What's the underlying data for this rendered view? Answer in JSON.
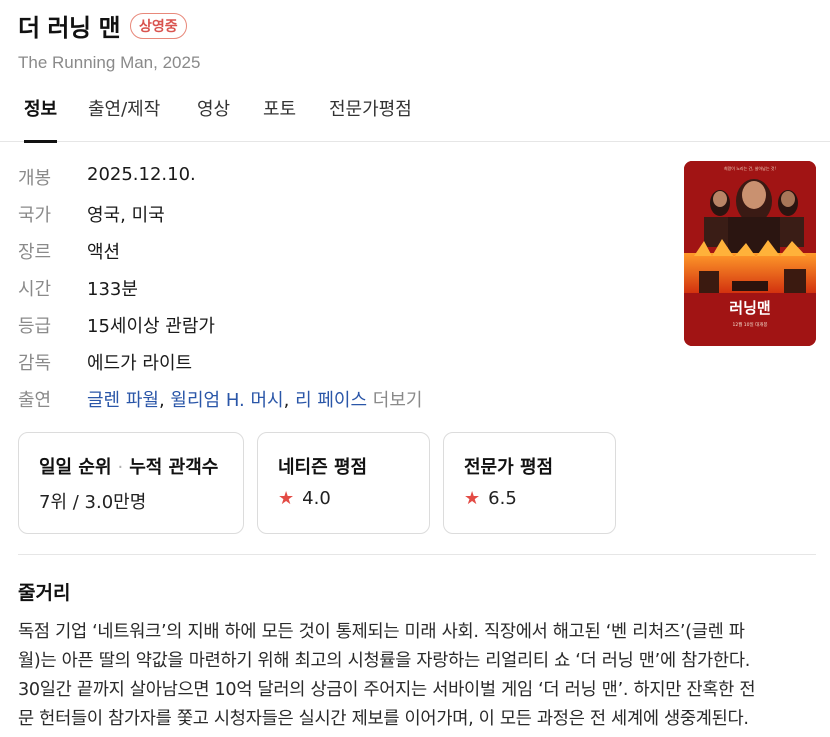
{
  "header": {
    "title": "더 러닝 맨",
    "badge": "상영중",
    "subtitle": "The Running Man, 2025"
  },
  "tabs": [
    {
      "label": "정보",
      "active": true
    },
    {
      "label": "출연/제작",
      "active": false
    },
    {
      "label": "영상",
      "active": false
    },
    {
      "label": "포토",
      "active": false
    },
    {
      "label": "전문가평점",
      "active": false
    }
  ],
  "info": {
    "release": {
      "label": "개봉",
      "value": "2025.12.10."
    },
    "country": {
      "label": "국가",
      "value": "영국, 미국"
    },
    "genre": {
      "label": "장르",
      "value": "액션"
    },
    "runtime": {
      "label": "시간",
      "value": "133분"
    },
    "rating": {
      "label": "등급",
      "value": "15세이상 관람가"
    },
    "director": {
      "label": "감독",
      "value": "에드가 라이트"
    },
    "cast": {
      "label": "출연",
      "names": [
        "글렌 파월",
        "윌리엄 H. 머시",
        "리 페이스"
      ],
      "separator": ", ",
      "more": "더보기"
    }
  },
  "poster": {
    "caption_top": "희망이 노리는 건, 살아남는 것!",
    "title_text": "러닝맨",
    "release_text": "12월 10일 대개봉"
  },
  "stats": {
    "ranking": {
      "title_a": "일일 순위",
      "title_b": "누적 관객수",
      "value": "7위 / 3.0만명"
    },
    "netizen": {
      "title": "네티즌 평점",
      "value": "4.0"
    },
    "critic": {
      "title": "전문가 평점",
      "value": "6.5"
    }
  },
  "synopsis": {
    "title": "줄거리",
    "lines": [
      "독점 기업 ‘네트워크’의 지배 하에 모든 것이 통제되는 미래 사회. 직장에서 해고된 ‘벤 리처즈’(글렌 파",
      "월)는 아픈 딸의 약값을 마련하기 위해 최고의 시청률을 자랑하는 리얼리티 쇼 ‘더 러닝 맨’에 참가한다.",
      "30일간 끝까지 살아남으면 10억 달러의 상금이 주어지는 서바이벌 게임 ‘더 러닝 맨’. 하지만 잔혹한 전",
      "문 헌터들이 참가자를 쫓고 시청자들은 실시간 제보를 이어가며, 이 모든 과정은 전 세계에 생중계된다."
    ]
  },
  "colors": {
    "link": "#2a56a8",
    "badge_text": "#d9534f",
    "badge_border": "#e8887a",
    "star": "#e34b45",
    "label_gray": "#8a8a8a"
  },
  "icons": {
    "rating_star": "★"
  }
}
